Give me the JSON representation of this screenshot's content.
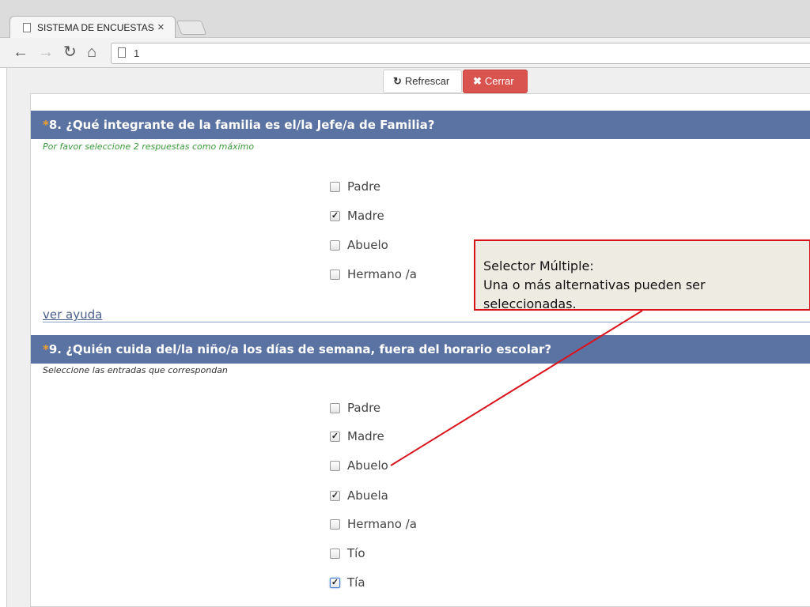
{
  "browser": {
    "tab_title": "SISTEMA DE ENCUESTAS -",
    "tab_close": "×",
    "address": "1"
  },
  "toolbar_buttons": {
    "refresh_icon": "↻",
    "refresh_label": "Refrescar",
    "close_icon": "✖",
    "close_label": "Cerrar",
    "close_color": "#d9534f"
  },
  "questions": [
    {
      "required_mark": "*",
      "title": "8. ¿Qué integrante de la familia es el/la Jefe/a de Familia?",
      "hint": "Por favor seleccione 2 respuestas como máximo",
      "options": [
        {
          "label": "Padre",
          "checked": false
        },
        {
          "label": "Madre",
          "checked": true
        },
        {
          "label": "Abuelo",
          "checked": false
        },
        {
          "label": "Hermano /a",
          "checked": false
        }
      ],
      "help_link": "ver ayuda"
    },
    {
      "required_mark": "*",
      "title": "9. ¿Quién cuida del/la niño/a los días de semana, fuera del horario escolar?",
      "hint": "Seleccione las entradas que correspondan",
      "options": [
        {
          "label": "Padre",
          "checked": false
        },
        {
          "label": "Madre",
          "checked": true
        },
        {
          "label": "Abuelo",
          "checked": false
        },
        {
          "label": "Abuela",
          "checked": true
        },
        {
          "label": "Hermano /a",
          "checked": false
        },
        {
          "label": "Tío",
          "checked": false
        },
        {
          "label": "Tía",
          "checked": true
        }
      ]
    }
  ],
  "callout": {
    "line1": "Selector Múltiple:",
    "line2": "Una o más alternativas pueden ser seleccionadas.",
    "border_color": "#d9121b"
  },
  "colors": {
    "question_header_bg": "#5a73a2",
    "required_mark": "#f0a030",
    "hint_green": "#3a9a3a"
  }
}
